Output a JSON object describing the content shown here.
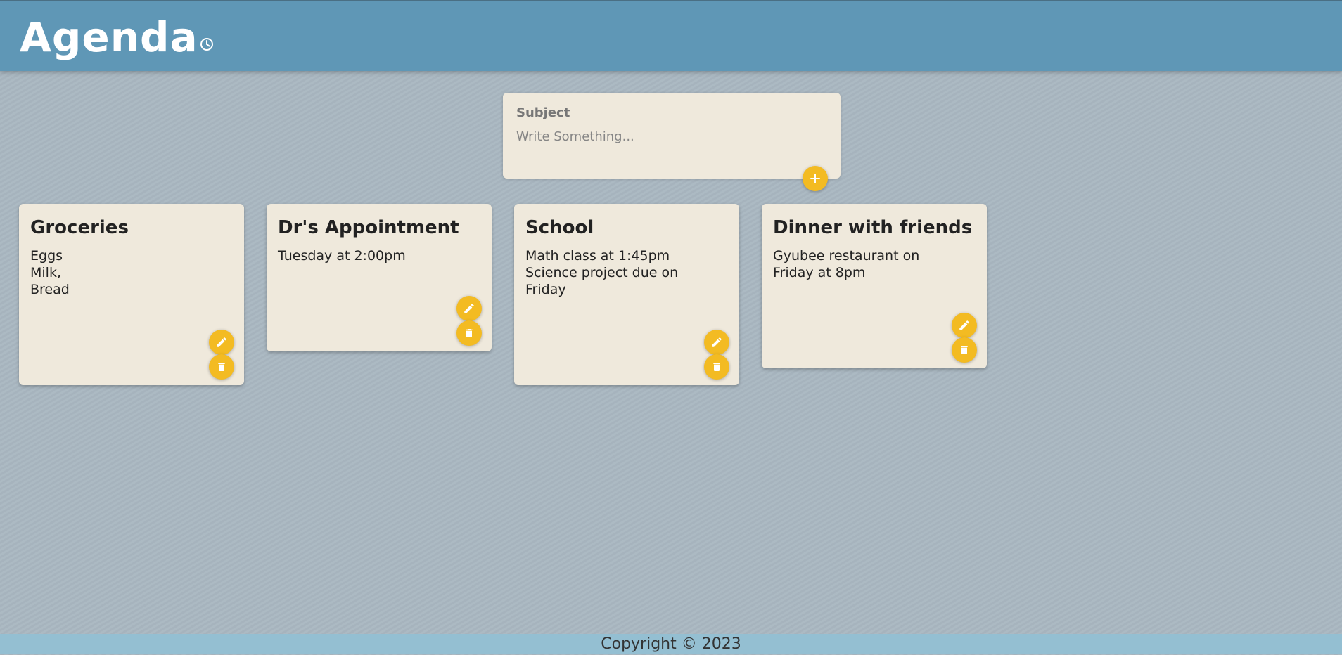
{
  "header": {
    "title": "Agenda",
    "logo_icon": "clock-icon"
  },
  "composer": {
    "subject_placeholder": "Subject",
    "body_placeholder": "Write Something...",
    "add_icon": "plus-icon"
  },
  "notes": [
    {
      "title": "Groceries",
      "lines": [
        "Eggs",
        "Milk,",
        "Bread"
      ]
    },
    {
      "title": "Dr's Appointment",
      "lines": [
        "Tuesday at 2:00pm"
      ]
    },
    {
      "title": "School",
      "lines": [
        "Math class at 1:45pm",
        "Science project due on",
        "Friday"
      ]
    },
    {
      "title": "Dinner with friends",
      "lines": [
        "Gyubee restaurant on",
        "Friday at 8pm"
      ]
    }
  ],
  "note_actions": {
    "edit_icon": "pencil-icon",
    "delete_icon": "trash-icon"
  },
  "footer": {
    "text": "Copyright © 2023"
  },
  "colors": {
    "header": "#5f97b6",
    "background": "#a9b7c1",
    "card": "#efe9dc",
    "accent": "#f3bb22",
    "footer": "#94bfd2"
  }
}
